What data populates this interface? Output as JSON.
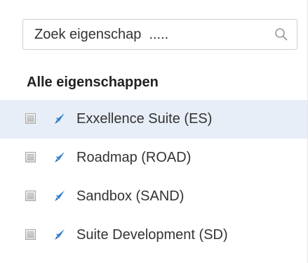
{
  "search": {
    "placeholder": "Zoek eigenschap  .....",
    "icon": "search-icon"
  },
  "heading": "Alle eigenschappen",
  "colors": {
    "selected_row_background": "#e8eef7",
    "icon_blue": "#2f7fd1"
  },
  "items": [
    {
      "label": "Exxellence Suite (ES)",
      "checked": false,
      "selected": true,
      "icon": "rocket-icon"
    },
    {
      "label": "Roadmap (ROAD)",
      "checked": false,
      "selected": false,
      "icon": "rocket-icon"
    },
    {
      "label": "Sandbox (SAND)",
      "checked": false,
      "selected": false,
      "icon": "rocket-icon"
    },
    {
      "label": "Suite Development (SD)",
      "checked": false,
      "selected": false,
      "icon": "rocket-icon"
    }
  ]
}
